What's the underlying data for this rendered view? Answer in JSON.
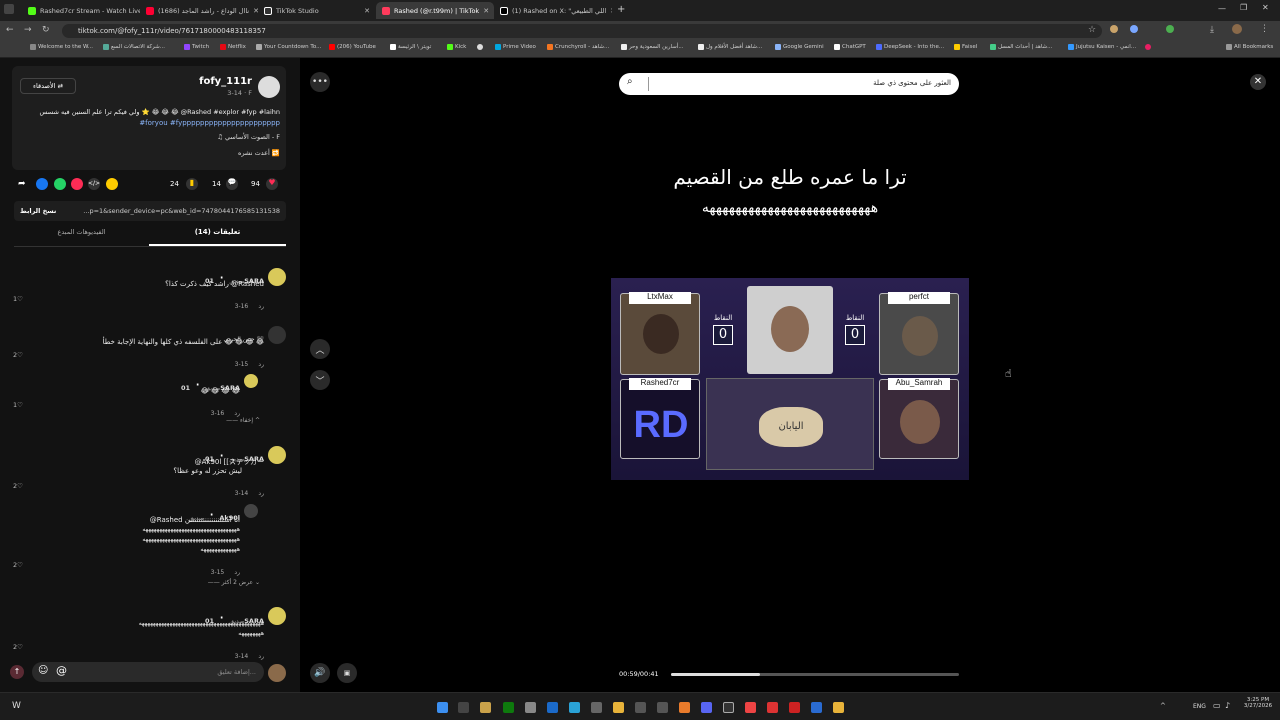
{
  "tabs": [
    {
      "label": "Rashed7cr Stream - Watch Live",
      "color": "#53fc18"
    },
    {
      "label": "ناال الوداع - راشد الماجد (1686)",
      "color": "#ff0033"
    },
    {
      "label": "TikTok Studio",
      "color": "#ffffff"
    },
    {
      "label": "Rashed (@r.t99m) | TikTok",
      "color": "#ff3b5c"
    },
    {
      "label": "(1) Rashed on X: \"اللي الطبيعي",
      "color": "#ffffff"
    }
  ],
  "address": {
    "url": "tiktok.com/@fofy_111r/video/7617180000483118357"
  },
  "bookmarks": [
    "Welcome to the W...",
    "شركة الاتصالات السع...",
    "Twitch",
    "Netflix",
    "Your Countdown To...",
    "(206) YouTube",
    "تويتر \\ الرئيسة",
    "Kick",
    "",
    "Prime Video",
    "Crunchyroll - شاهد...",
    "أسارين السعودية وحر...",
    "شاهد أفضل الأفلام ول...",
    "Google Gemini",
    "ChatGPT",
    "DeepSeek - Into the...",
    "Faisel",
    "شاهد | أحداث المسل...",
    "Jujutsu Kaisen - انمي...",
    "",
    "All Bookmarks"
  ],
  "post": {
    "username": "fofy_111r",
    "meta": "3-14 · F",
    "friends_button": "الأصدقاء",
    "caption": "ولي فيكم ترا علم السنين فيه شسس ⭐ 😂 😂 😂 @Rashed #explor #fyp #laihn",
    "caption2": "#foryou #fypppppppppppppppppppppp",
    "music": "الصوت الأساسي - F",
    "reposted": "أعدت نشره",
    "likes_count": "94",
    "comments_count": "14",
    "saves_count": "24",
    "copy_link_label": "نسخ الرابط",
    "link_value": "...p=1&sender_device=pc&web_id=7478044176585131538"
  },
  "tabs_panel": {
    "comments_tab": "تعليقات (14)",
    "creator_tab": "الفيديوهات المبدع"
  },
  "comments": [
    {
      "name": "01SARA",
      "tag": "صديق",
      "text": "راشد كيف ذكرت كذا؟ @Rashed",
      "date": "3-16",
      "reply": "رد",
      "likes": "1"
    },
    {
      "name": "حنين الحربي 🖤",
      "tag": "",
      "text": "على الفلسفه ذي كلها والنهاية الإجابة خطأ 😂 😂 😂 😂",
      "date": "3-15",
      "reply": "رد",
      "likes": "2"
    },
    {
      "name": "01SARA",
      "tag": "صديق",
      "text": "😂 😂 😂 😂",
      "date": "3-16",
      "reply": "رد",
      "likes": "1"
    },
    {
      "name": "01SARA",
      "tag": "صديق",
      "text": "@Ak90l [[ステッカー",
      "text2": "ليش تحزر له وعو عظا؟",
      "date": "3-14",
      "reply": "رد",
      "likes": "2"
    },
    {
      "name": "Ak90l",
      "tag": "صديق",
      "text": "@Rashed انا استنننننننننننننننن",
      "text2": "ههههههههههههههههههههههههههههههههههه",
      "text3": "ههههههههههههههههههههههههههههههههههه",
      "text4": "هههههههههههههه",
      "date": "3-15",
      "reply": "رد",
      "likes": "2"
    },
    {
      "name": "01SARA",
      "tag": "صديق",
      "text": "ههههههههههههههههههههههههههههههههههههههههههههه",
      "text2": "ههههههههه",
      "date": "3-14",
      "reply": "رد",
      "likes": "2"
    }
  ],
  "hide_label": "إخفاء",
  "show_more_label": "عرض 2 أكثر",
  "comment_input": {
    "placeholder": "إضافة تعليق..."
  },
  "search": {
    "placeholder": "العثور على محتوى ذي صلة"
  },
  "video": {
    "caption_line1": "ترا ما عمره طلع من القصيم",
    "caption_line2": "ههههههههههههههههههههههههههه",
    "players": [
      "LtxMax",
      "perfct",
      "Rashed7cr",
      "Abu_Samrah"
    ],
    "score_label": "النقاط",
    "score_left": "0",
    "score_right": "0",
    "center_answer": "اليابان",
    "time": "00:59/00:41",
    "progress": 0.31
  },
  "taskbar": {
    "lang": "ENG",
    "time": "3:25 PM",
    "date": "3/27/2026"
  }
}
